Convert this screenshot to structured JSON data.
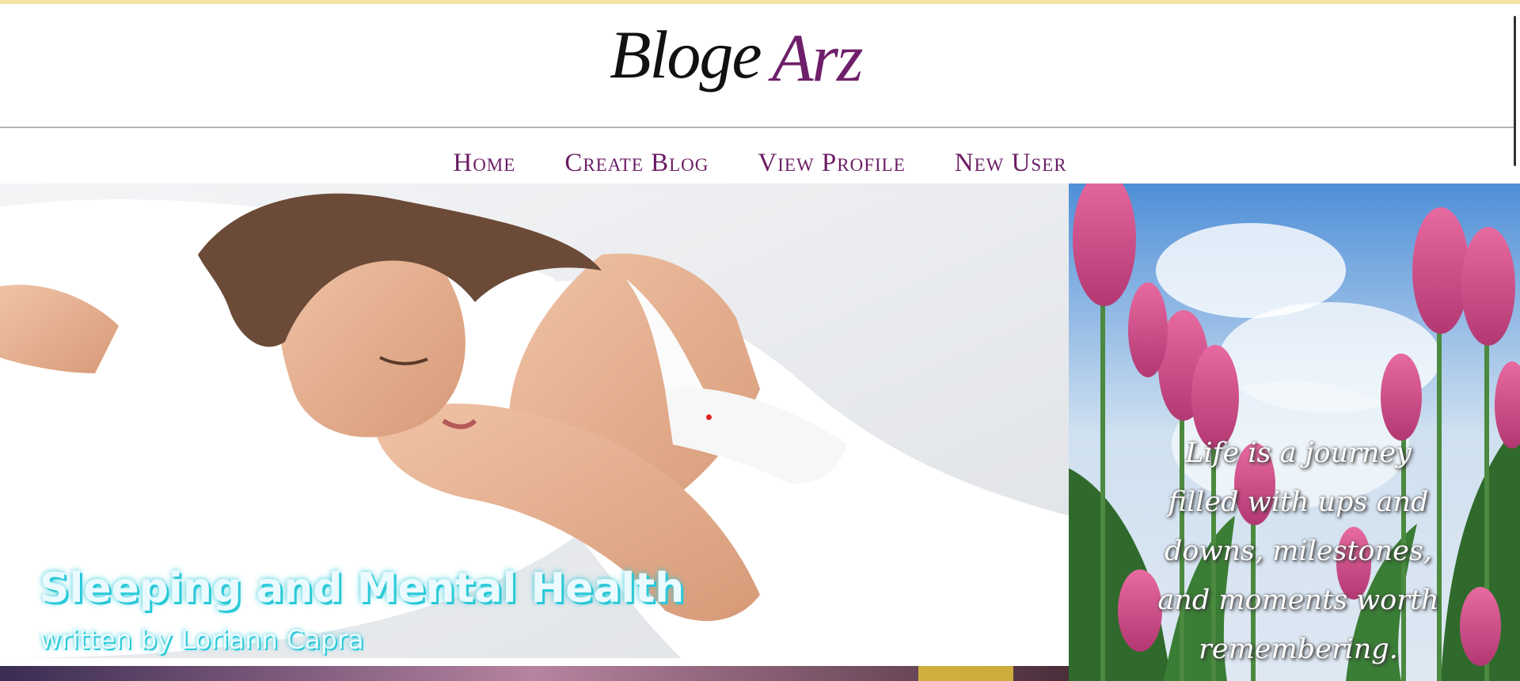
{
  "header": {
    "logo_part1": "Bloge",
    "logo_part2": "Arz"
  },
  "nav": {
    "items": [
      {
        "label": "Home"
      },
      {
        "label": "Create Blog"
      },
      {
        "label": "View Profile"
      },
      {
        "label": "New User"
      }
    ]
  },
  "featured": {
    "title": "Sleeping and Mental Health",
    "author": "written by Loriann Capra"
  },
  "sidebar": {
    "quote": "Life is a journey filled with ups and downs, milestones, and moments worth remembering."
  },
  "colors": {
    "brand_purple": "#6b1c64",
    "top_bar": "#f7e3a8",
    "title_glow": "#29c9d8"
  }
}
